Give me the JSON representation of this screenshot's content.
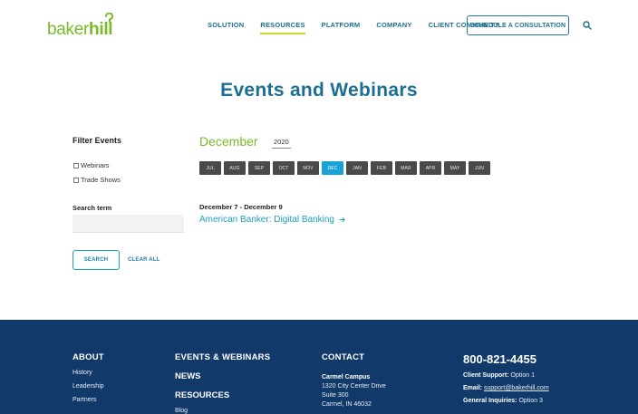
{
  "header": {
    "logo_baker": "baker",
    "logo_hill": "hill",
    "nav": [
      "SOLUTION",
      "RESOURCES",
      "PLATFORM",
      "COMPANY",
      "CLIENT COMMUNITY"
    ],
    "active_nav": "RESOURCES",
    "cta_label": "SCHEDULE A CONSULTATION",
    "search_icon": "search-icon"
  },
  "page": {
    "title": "Events and Webinars"
  },
  "sidebar": {
    "filter_title": "Filter Events",
    "filters": [
      {
        "label": "Webinars",
        "checked": false
      },
      {
        "label": "Trade Shows",
        "checked": false
      }
    ],
    "search_label": "Search term",
    "search_value": "",
    "search_button": "SEARCH",
    "clear_all": "CLEAR ALL"
  },
  "main": {
    "month": "December",
    "year": "2020",
    "months": [
      "JUL",
      "AUG",
      "SEP",
      "OCT",
      "NOV",
      "DEC",
      "JAN",
      "FEB",
      "MAR",
      "APR",
      "MAY",
      "JUN"
    ],
    "active_month": "DEC",
    "event": {
      "date": "December 7 - December 9",
      "title": "American Banker: Digital Banking"
    }
  },
  "footer": {
    "about": {
      "heading": "ABOUT",
      "links": [
        "History",
        "Leadership",
        "Partners"
      ]
    },
    "events": {
      "heading": "EVENTS & WEBINARS",
      "news": "NEWS",
      "resources": "RESOURCES",
      "resource_links": [
        "Blog"
      ]
    },
    "contact": {
      "heading": "CONTACT",
      "campus": "Carmel Campus",
      "address": [
        "1320 City Center Drive",
        "Suite 300",
        "Carmel, IN 46032"
      ]
    },
    "phone": {
      "number": "800-821-4455",
      "client_support_label": "Client Support:",
      "client_support_value": "Option 1",
      "email_label": "Email:",
      "email_value": "support@bakerhill.com",
      "general_label": "General Inquiries:",
      "general_value": "Option 3"
    }
  },
  "colors": {
    "brand_blue": "#1b6f93",
    "brand_green": "#7ab929",
    "accent_cyan": "#1ba3d8",
    "footer_bg": "#113a6b"
  }
}
